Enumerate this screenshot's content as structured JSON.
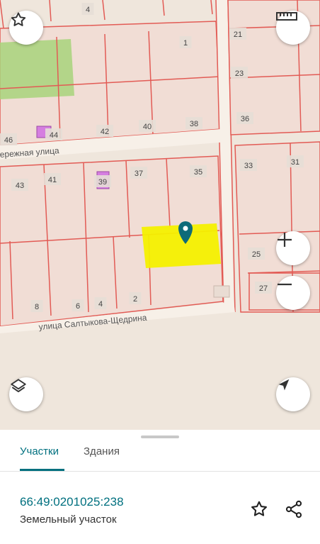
{
  "map": {
    "parcel_numbers": [
      "4",
      "1",
      "21",
      "23",
      "36",
      "46",
      "44",
      "42",
      "40",
      "38",
      "33",
      "31",
      "43",
      "41",
      "39",
      "37",
      "35",
      "25",
      "27",
      "8",
      "6",
      "4",
      "2"
    ],
    "streets": [
      "ережная улица",
      "улица Салтыкова-Щедрина"
    ],
    "colors": {
      "background": "#efe6dc",
      "parcel_fill": "#f1ddd5",
      "parcel_border": "#e25b55",
      "road": "#f7f0e8",
      "green_area": "#a8d47b",
      "selected_parcel": "#f4f000",
      "marker": "#0e6b79",
      "building": "#d57ee0"
    }
  },
  "controls": {
    "favorite_icon": "star-outline-icon",
    "ruler_icon": "ruler-icon",
    "zoom_in_icon": "plus-icon",
    "zoom_out_icon": "minus-icon",
    "layers_icon": "layers-icon",
    "location_icon": "navigation-arrow-icon"
  },
  "sheet": {
    "tabs": [
      {
        "label": "Участки",
        "active": true
      },
      {
        "label": "Здания",
        "active": false
      }
    ],
    "cadastral_number": "66:49:0201025:238",
    "object_type": "Земельный участок",
    "accent_color": "#00707f"
  }
}
